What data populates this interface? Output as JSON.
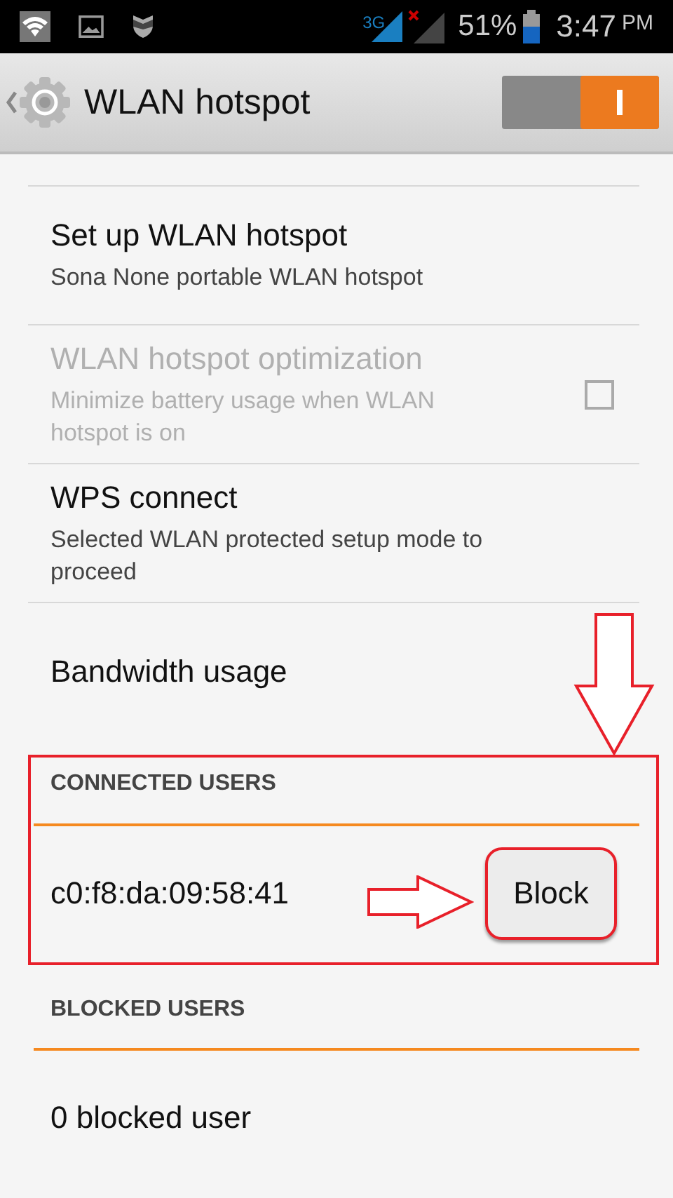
{
  "status_bar": {
    "network": "3G",
    "battery": "51%",
    "time": "3:47",
    "time_suffix": "PM"
  },
  "action_bar": {
    "title": "WLAN hotspot",
    "switch_on": true
  },
  "settings": [
    {
      "kind": "item",
      "title": "Set up WLAN hotspot",
      "summary": "Sona None portable WLAN hotspot",
      "disabled": false
    },
    {
      "kind": "checkbox",
      "title": "WLAN hotspot optimization",
      "summary": "Minimize battery usage when WLAN hotspot is on",
      "disabled": true,
      "checked": false
    },
    {
      "kind": "item",
      "title": "WPS connect",
      "summary": "Selected WLAN protected setup mode to proceed",
      "disabled": false
    },
    {
      "kind": "item",
      "title": "Bandwidth usage",
      "disabled": false
    }
  ],
  "connected_users": {
    "header": "CONNECTED USERS",
    "users": [
      {
        "address": "c0:f8:da:09:58:41",
        "button": "Block"
      }
    ]
  },
  "blocked_users": {
    "header": "BLOCKED USERS",
    "summary": "0 blocked user"
  }
}
